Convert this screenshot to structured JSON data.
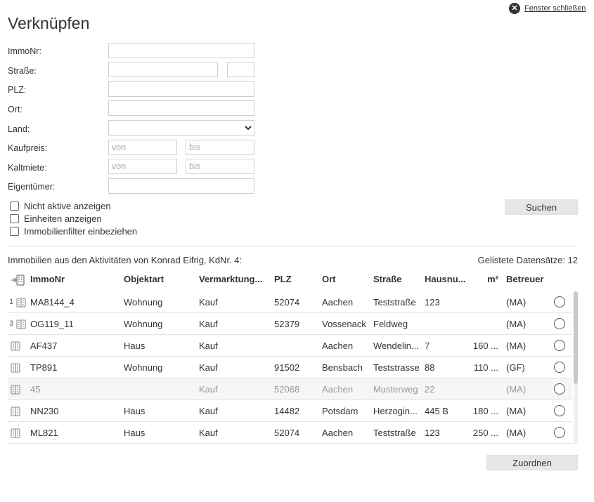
{
  "window": {
    "close_label": "Fenster schließen",
    "title": "Verknüpfen"
  },
  "form": {
    "immonr_label": "ImmoNr:",
    "strasse_label": "Straße:",
    "plz_label": "PLZ:",
    "ort_label": "Ort:",
    "land_label": "Land:",
    "kaufpreis_label": "Kaufpreis:",
    "kaltmiete_label": "Kaltmiete:",
    "eigentuemer_label": "Eigentümer:",
    "von_placeholder": "von",
    "bis_placeholder": "bis"
  },
  "options": {
    "nicht_aktive": "Nicht aktive anzeigen",
    "einheiten": "Einheiten anzeigen",
    "immobilienfilter": "Immobilienfilter einbeziehen"
  },
  "buttons": {
    "suchen": "Suchen",
    "zuordnen": "Zuordnen"
  },
  "results": {
    "context_text": "Immobilien aus den Aktivitäten von Konrad Eifrig, KdNr. 4:",
    "count_text": "Gelistete Datensätze: 12",
    "columns": [
      "ImmoNr",
      "Objektart",
      "Vermarktung...",
      "PLZ",
      "Ort",
      "Straße",
      "Hausnu...",
      "m²",
      "Betreuer"
    ],
    "rows": [
      {
        "num": "1",
        "immonr": "MA8144_4",
        "objektart": "Wohnung",
        "vermarktung": "Kauf",
        "plz": "52074",
        "ort": "Aachen",
        "strasse": "Teststraße",
        "hausnr": "123",
        "m2": "",
        "betreuer": "(MA)",
        "inactive": false
      },
      {
        "num": "3",
        "immonr": "OG119_11",
        "objektart": "Wohnung",
        "vermarktung": "Kauf",
        "plz": "52379",
        "ort": "Vossenack",
        "strasse": "Feldweg",
        "hausnr": "",
        "m2": "",
        "betreuer": "(MA)",
        "inactive": false
      },
      {
        "num": "",
        "immonr": "AF437",
        "objektart": "Haus",
        "vermarktung": "Kauf",
        "plz": "",
        "ort": "Aachen",
        "strasse": "Wendelin...",
        "hausnr": "7",
        "m2": "160 ...",
        "betreuer": "(MA)",
        "inactive": false
      },
      {
        "num": "",
        "immonr": "TP891",
        "objektart": "Wohnung",
        "vermarktung": "Kauf",
        "plz": "91502",
        "ort": "Bensbach",
        "strasse": "Teststrasse",
        "hausnr": "88",
        "m2": "110 ...",
        "betreuer": "(GF)",
        "inactive": false
      },
      {
        "num": "",
        "immonr": "45",
        "objektart": "",
        "vermarktung": "Kauf",
        "plz": "52068",
        "ort": "Aachen",
        "strasse": "Musterweg",
        "hausnr": "22",
        "m2": "",
        "betreuer": "(MA)",
        "inactive": true
      },
      {
        "num": "",
        "immonr": "NN230",
        "objektart": "Haus",
        "vermarktung": "Kauf",
        "plz": "14482",
        "ort": "Potsdam",
        "strasse": "Herzogin...",
        "hausnr": "445 B",
        "m2": "180 ...",
        "betreuer": "(MA)",
        "inactive": false
      },
      {
        "num": "",
        "immonr": "ML821",
        "objektart": "Haus",
        "vermarktung": "Kauf",
        "plz": "52074",
        "ort": "Aachen",
        "strasse": "Teststraße",
        "hausnr": "123",
        "m2": "250 ...",
        "betreuer": "(MA)",
        "inactive": false
      }
    ]
  }
}
